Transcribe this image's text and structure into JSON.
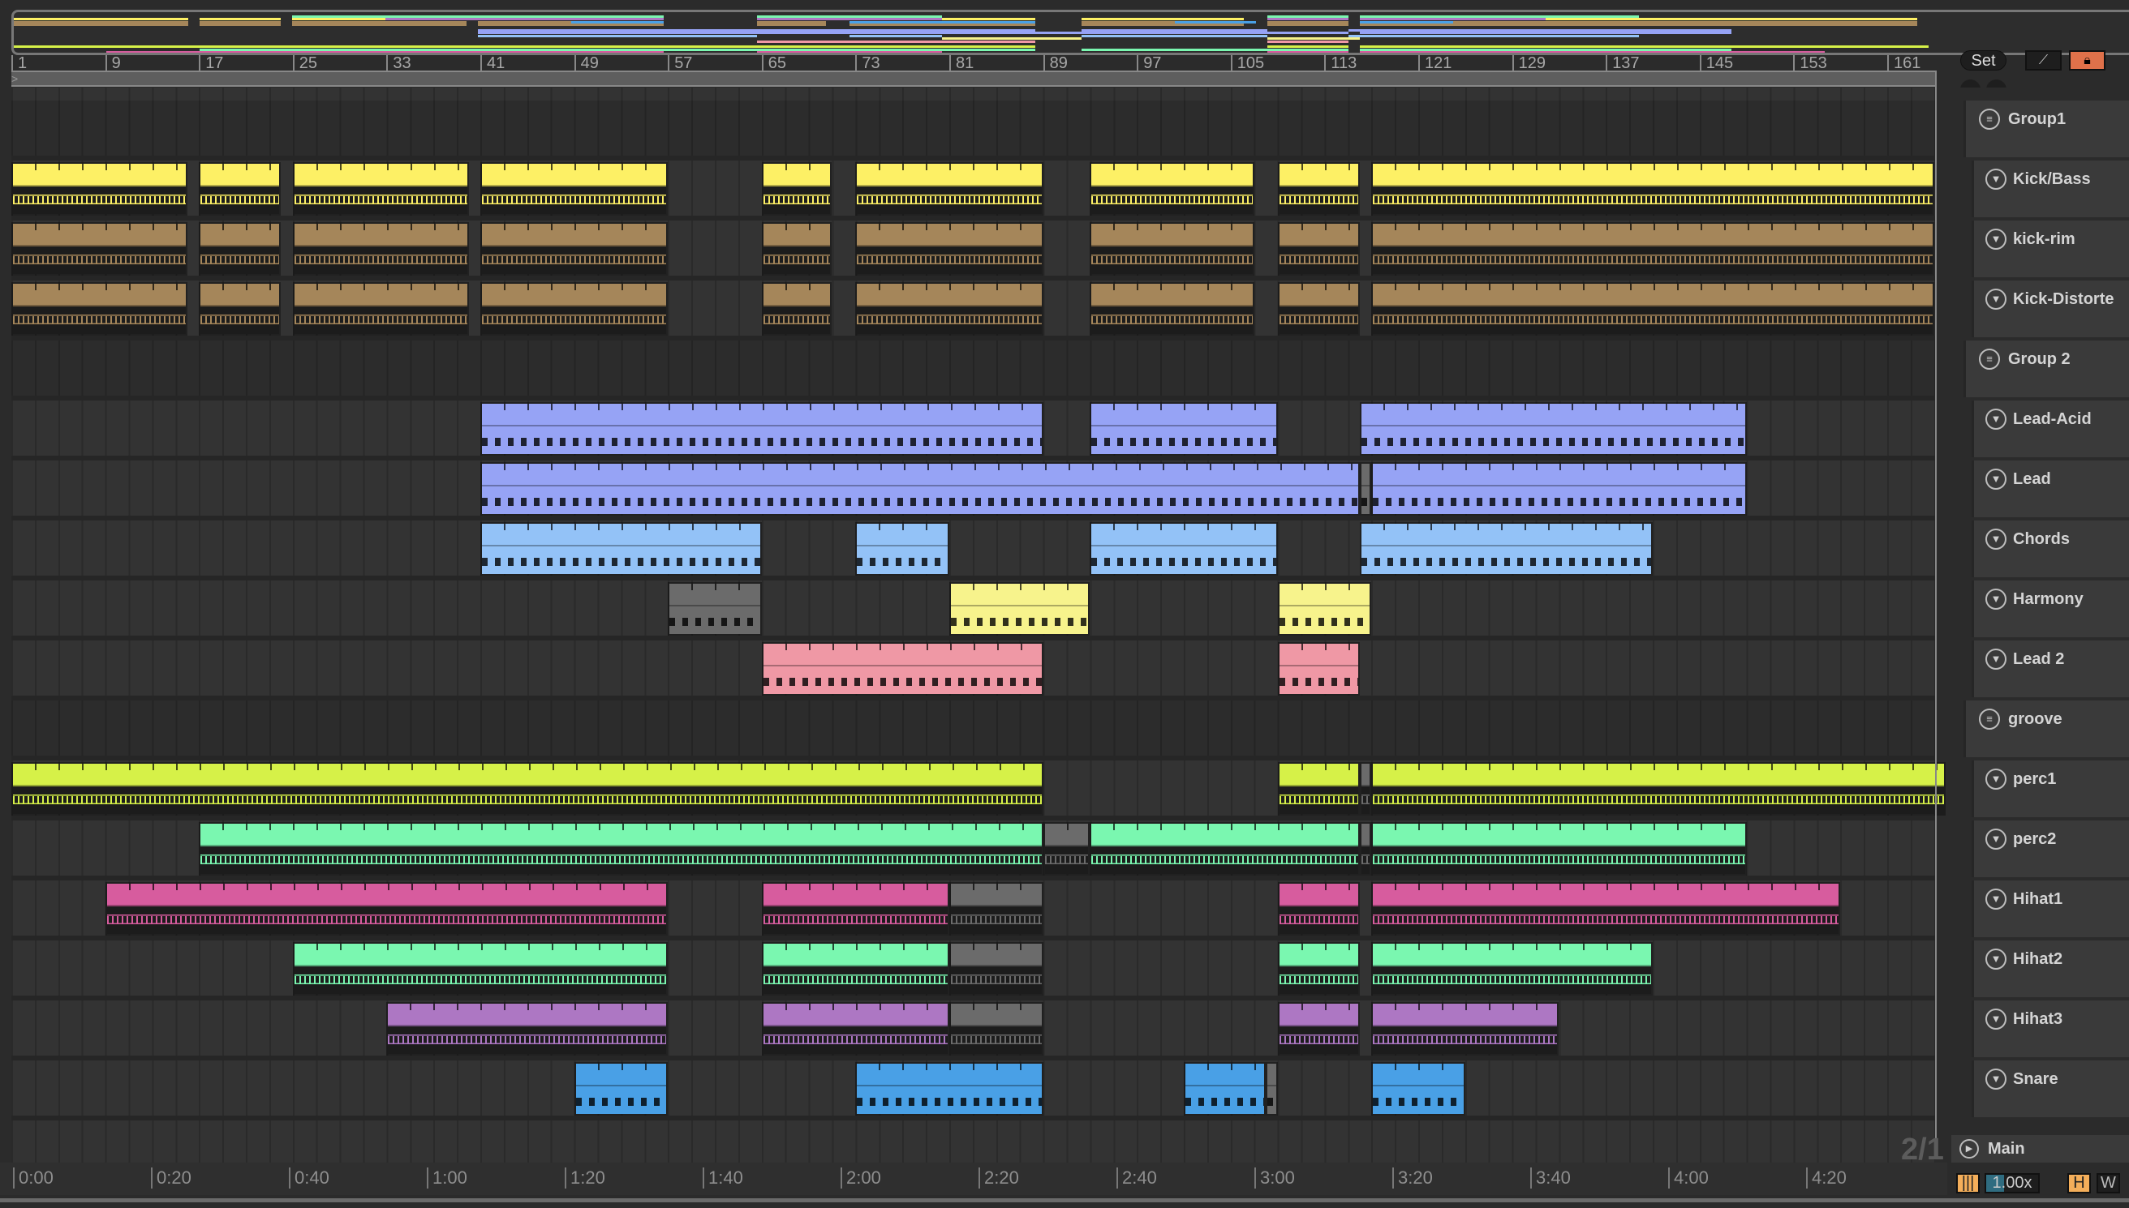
{
  "ruler": {
    "bars": [
      "1",
      "9",
      "17",
      "25",
      "33",
      "41",
      "49",
      "57",
      "65",
      "73",
      "81",
      "89",
      "97",
      "105",
      "113",
      "121",
      "129",
      "137",
      "145",
      "153",
      "161"
    ]
  },
  "timeline": {
    "labels": [
      "0:00",
      "0:20",
      "0:40",
      "1:00",
      "1:20",
      "1:40",
      "2:00",
      "2:20",
      "2:40",
      "3:00",
      "3:20",
      "3:40",
      "4:00",
      "4:20"
    ]
  },
  "controls": {
    "set_label": "Set",
    "draw_icon": "draw-mode-icon",
    "lock_icon": "lock-icon",
    "back_icon": "arrow-left-icon",
    "forward_icon": "arrow-right-icon",
    "lock_color": "#df714a"
  },
  "tracks": [
    {
      "name": "Group1",
      "kind": "group",
      "color": "#555",
      "clips": []
    },
    {
      "name": "Kick/Bass",
      "kind": "audio",
      "color": "#fdf065",
      "clips": [
        [
          1,
          16
        ],
        [
          17,
          24
        ],
        [
          25,
          40
        ],
        [
          41,
          57
        ],
        [
          65,
          71
        ],
        [
          73,
          89
        ],
        [
          93,
          107
        ],
        [
          109,
          116
        ],
        [
          117,
          165
        ]
      ]
    },
    {
      "name": "kick-rim",
      "kind": "audio",
      "color": "#a5865a",
      "clips": [
        [
          1,
          16
        ],
        [
          17,
          24
        ],
        [
          25,
          40
        ],
        [
          41,
          57
        ],
        [
          65,
          71
        ],
        [
          73,
          89
        ],
        [
          93,
          107
        ],
        [
          109,
          116
        ],
        [
          117,
          165
        ]
      ]
    },
    {
      "name": "Kick-Distorte",
      "kind": "audio",
      "color": "#a5865a",
      "clips": [
        [
          1,
          16
        ],
        [
          17,
          24
        ],
        [
          25,
          40
        ],
        [
          41,
          57
        ],
        [
          65,
          71
        ],
        [
          73,
          89
        ],
        [
          93,
          107
        ],
        [
          109,
          116
        ],
        [
          117,
          165
        ]
      ]
    },
    {
      "name": "Group 2",
      "kind": "group",
      "color": "#555",
      "clips": []
    },
    {
      "name": "Lead-Acid",
      "kind": "midi",
      "color": "#96a3f5",
      "clips": [
        [
          41,
          89
        ],
        [
          93,
          109
        ],
        [
          116,
          149
        ]
      ]
    },
    {
      "name": "Lead",
      "kind": "midi",
      "color": "#96a3f5",
      "clips": [
        [
          41,
          116
        ],
        [
          116,
          117,
          "off"
        ],
        [
          117,
          149
        ]
      ]
    },
    {
      "name": "Chords",
      "kind": "midi",
      "color": "#93c2f7",
      "clips": [
        [
          41,
          65
        ],
        [
          73,
          81
        ],
        [
          93,
          109
        ],
        [
          116,
          141
        ]
      ]
    },
    {
      "name": "Harmony",
      "kind": "midi",
      "color": "#f7f38c",
      "clips": [
        [
          57,
          65,
          "off"
        ],
        [
          81,
          93
        ],
        [
          109,
          117
        ]
      ]
    },
    {
      "name": "Lead 2",
      "kind": "midi",
      "color": "#ef98a5",
      "clips": [
        [
          65,
          89
        ],
        [
          109,
          116
        ]
      ]
    },
    {
      "name": "groove",
      "kind": "group",
      "color": "#555",
      "clips": []
    },
    {
      "name": "perc1",
      "kind": "audio",
      "color": "#d6f148",
      "clips": [
        [
          1,
          89
        ],
        [
          109,
          116
        ],
        [
          116,
          117,
          "off"
        ],
        [
          117,
          166
        ]
      ]
    },
    {
      "name": "perc2",
      "kind": "audio",
      "color": "#7af7b0",
      "clips": [
        [
          17,
          89
        ],
        [
          89,
          93,
          "off"
        ],
        [
          93,
          116
        ],
        [
          116,
          117,
          "off"
        ],
        [
          117,
          149
        ]
      ]
    },
    {
      "name": "Hihat1",
      "kind": "audio",
      "color": "#d75c9e",
      "clips": [
        [
          9,
          57
        ],
        [
          65,
          81
        ],
        [
          81,
          89,
          "off"
        ],
        [
          109,
          116
        ],
        [
          117,
          157
        ]
      ]
    },
    {
      "name": "Hihat2",
      "kind": "audio",
      "color": "#7af7b0",
      "clips": [
        [
          25,
          57
        ],
        [
          65,
          81
        ],
        [
          81,
          89,
          "off"
        ],
        [
          109,
          116
        ],
        [
          117,
          141
        ]
      ]
    },
    {
      "name": "Hihat3",
      "kind": "audio",
      "color": "#ad77c3",
      "clips": [
        [
          33,
          57
        ],
        [
          65,
          81
        ],
        [
          81,
          89,
          "off"
        ],
        [
          109,
          116
        ],
        [
          117,
          133
        ]
      ]
    },
    {
      "name": "Snare",
      "kind": "midi",
      "color": "#49a0e6",
      "clips": [
        [
          49,
          57
        ],
        [
          73,
          89
        ],
        [
          101,
          108
        ],
        [
          108,
          109,
          "off"
        ],
        [
          117,
          125
        ]
      ]
    }
  ],
  "main": {
    "name": "Main",
    "time_signature": "2/1"
  },
  "bottom": {
    "tempo_follow_icon": "waveform-icon",
    "speed": "1.00x",
    "h_label": "H",
    "w_label": "W",
    "accent": "#f4ae5a"
  }
}
